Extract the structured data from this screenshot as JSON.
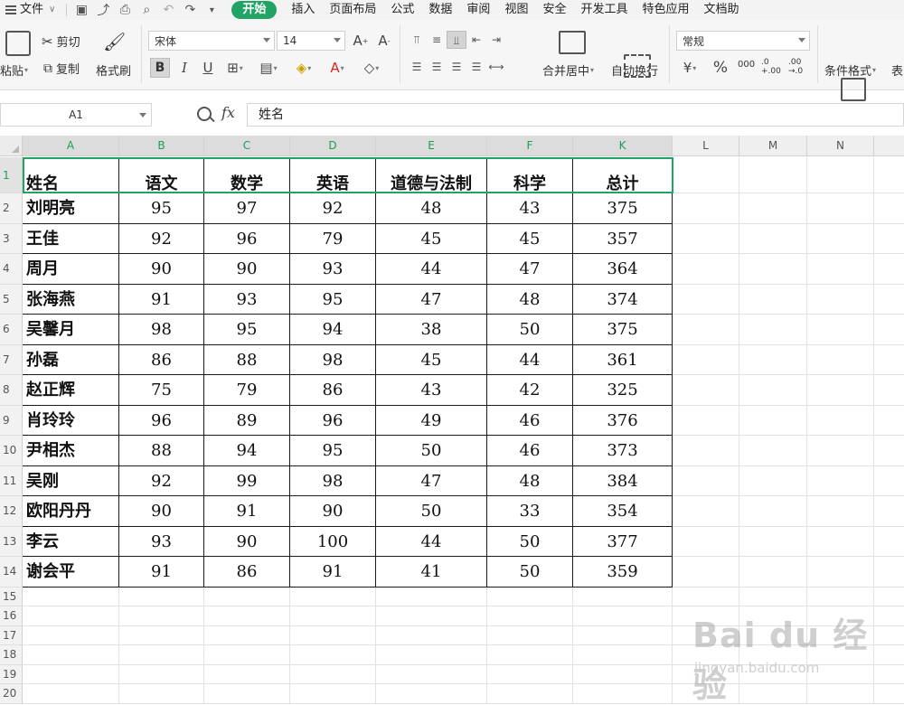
{
  "menubar": {
    "file_label": "文件",
    "tabs": [
      "开始",
      "插入",
      "页面布局",
      "公式",
      "数据",
      "审阅",
      "视图",
      "安全",
      "开发工具",
      "特色应用",
      "文档助"
    ]
  },
  "ribbon": {
    "paste_label": "粘贴",
    "cut_label": "剪切",
    "copy_label": "复制",
    "format_painter_label": "格式刷",
    "font_name": "宋体",
    "font_size": "14",
    "bold_label": "B",
    "italic_label": "I",
    "underline_label": "U",
    "merge_center_label": "合并居中",
    "wrap_text_label": "自动换行",
    "number_format": "常规",
    "percent_label": "%",
    "thousands_label": "000",
    "inc_decimal_label": ".0 +.00",
    "dec_decimal_label": ".00 →.0",
    "conditional_format_label": "条件格式",
    "table_label": "表"
  },
  "formula_bar": {
    "cell_ref": "A1",
    "fx_label": "fx",
    "content": "姓名"
  },
  "sheet": {
    "columns": [
      "A",
      "B",
      "C",
      "D",
      "E",
      "F",
      "K",
      "L",
      "M",
      "N"
    ],
    "row_numbers": [
      "1",
      "2",
      "3",
      "4",
      "5",
      "6",
      "7",
      "8",
      "9",
      "10",
      "11",
      "12",
      "13",
      "14",
      "15",
      "16",
      "17",
      "18",
      "19",
      "20"
    ],
    "header": [
      "姓名",
      "语文",
      "数学",
      "英语",
      "道德与法制",
      "科学",
      "总计"
    ],
    "rows": [
      [
        "刘明亮",
        "95",
        "97",
        "92",
        "48",
        "43",
        "375"
      ],
      [
        "王佳",
        "92",
        "96",
        "79",
        "45",
        "45",
        "357"
      ],
      [
        "周月",
        "90",
        "90",
        "93",
        "44",
        "47",
        "364"
      ],
      [
        "张海燕",
        "91",
        "93",
        "95",
        "47",
        "48",
        "374"
      ],
      [
        "吴馨月",
        "98",
        "95",
        "94",
        "38",
        "50",
        "375"
      ],
      [
        "孙磊",
        "86",
        "88",
        "98",
        "45",
        "44",
        "361"
      ],
      [
        "赵正辉",
        "75",
        "79",
        "86",
        "43",
        "42",
        "325"
      ],
      [
        "肖玲玲",
        "96",
        "89",
        "96",
        "49",
        "46",
        "376"
      ],
      [
        "尹相杰",
        "88",
        "94",
        "95",
        "50",
        "46",
        "373"
      ],
      [
        "吴刚",
        "92",
        "99",
        "98",
        "47",
        "48",
        "384"
      ],
      [
        "欧阳丹丹",
        "90",
        "91",
        "90",
        "50",
        "33",
        "354"
      ],
      [
        "李云",
        "93",
        "90",
        "100",
        "44",
        "50",
        "377"
      ],
      [
        "谢会平",
        "91",
        "86",
        "91",
        "41",
        "50",
        "359"
      ]
    ]
  },
  "watermark": {
    "brand": "Bai du 经验",
    "url": "jingyan.baidu.com"
  },
  "colors": {
    "accent_green": "#21a366",
    "selection_green": "#21a366"
  }
}
